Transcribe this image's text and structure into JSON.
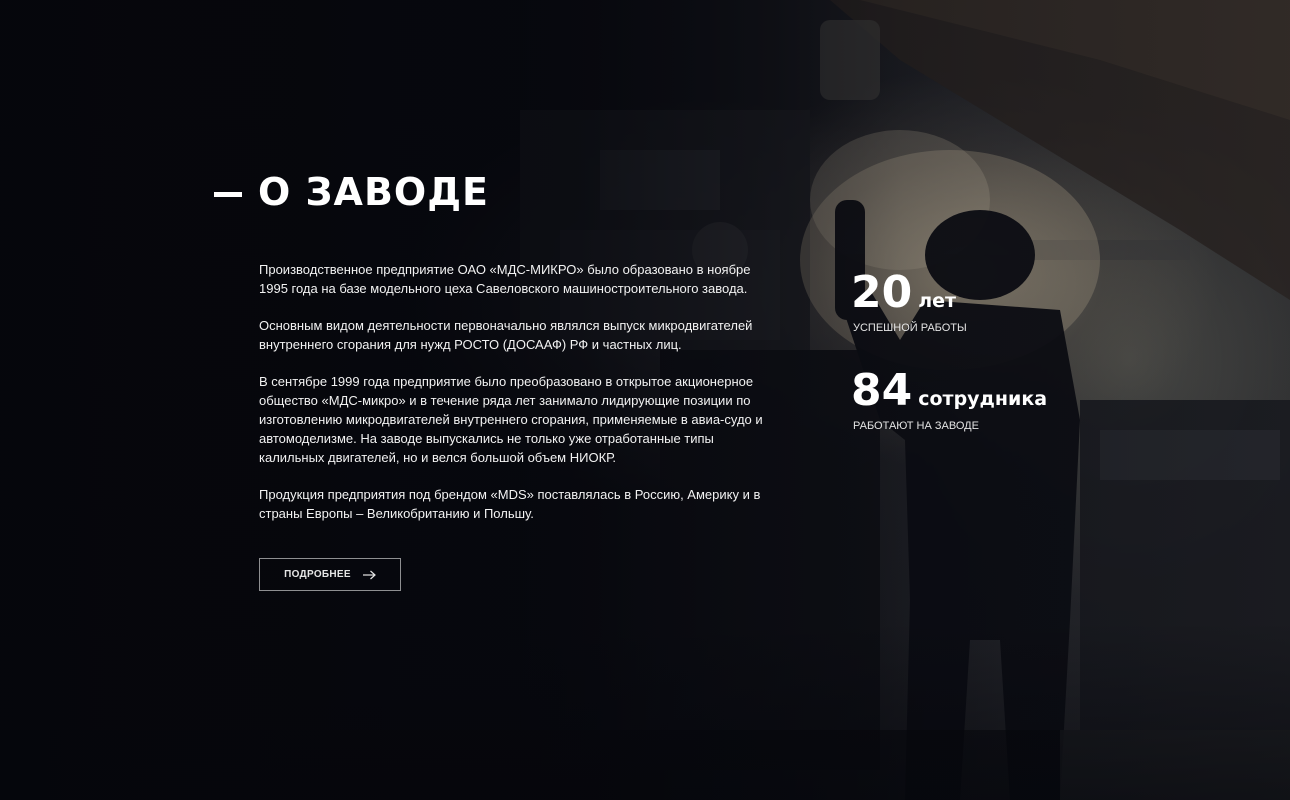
{
  "section": {
    "title": "О ЗАВОДЕ",
    "paragraphs": [
      "Производственное предприятие ОАО «МДС-МИКРО» было образовано в ноябре 1995 года на базе модельного цеха Савеловского машиностроительного завода.",
      "Основным видом деятельности первоначально являлся выпуск микродвигателей внутреннего сгорания для нужд РОСТО (ДОСААФ) РФ и частных лиц.",
      "В сентябре 1999 года предприятие было преобразовано в открытое акционерное общество «МДС-микро» и в течение ряда лет занимало лидирующие позиции по изготовлению микродвигателей внутреннего сгорания, применяемые в авиа-судо и автомоделизме. На заводе выпускались не только уже отработанные типы калильных двигателей, но и велся большой объем НИОКР.",
      "Продукция предприятия под брендом «MDS» поставлялась в Россию, Америку и в страны Европы – Великобританию и Польшу."
    ],
    "more_button": {
      "label": "ПОДРОБНЕЕ",
      "icon": "arrow-right-icon"
    }
  },
  "stats": [
    {
      "number": "20",
      "unit": "лет",
      "caption": "УСПЕШНОЙ РАБОТЫ"
    },
    {
      "number": "84",
      "unit": "сотрудника",
      "caption": "РАБОТАЮТ НА ЗАВОДЕ"
    }
  ],
  "colors": {
    "background": "#0b0c12",
    "text": "#ffffff",
    "button_border": "#8c8c8c"
  }
}
